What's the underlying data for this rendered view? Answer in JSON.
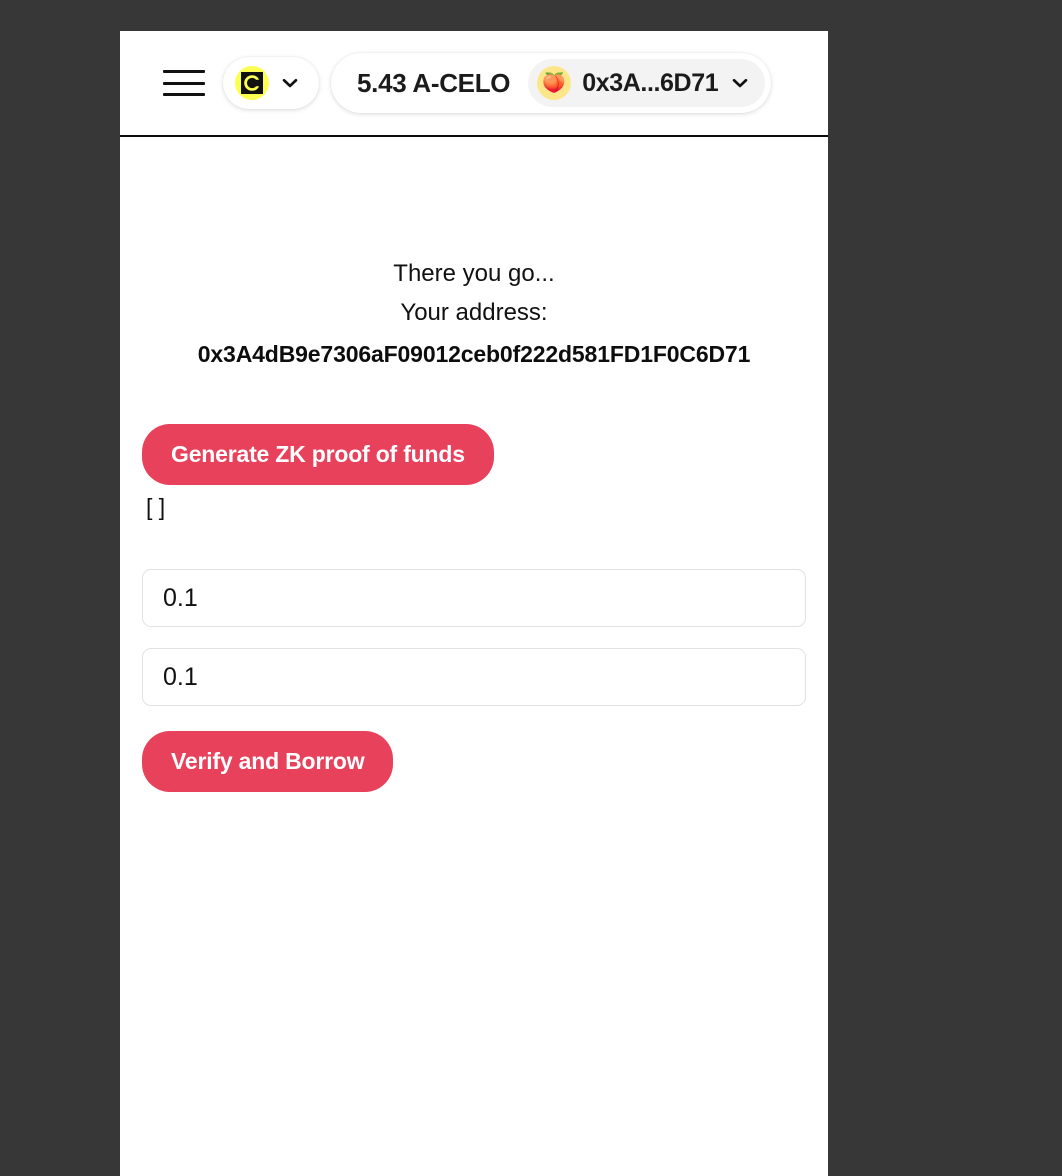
{
  "header": {
    "menu_icon": "hamburger-menu-icon",
    "network": {
      "logo_icon": "celo-logo-icon",
      "chevron_icon": "chevron-down-icon"
    },
    "balance": "5.43 A-CELO",
    "account": {
      "avatar_emoji": "🍑",
      "address_short": "0x3A...6D71",
      "chevron_icon": "chevron-down-icon"
    }
  },
  "main": {
    "greeting": "There you go...",
    "address_label": "Your address:",
    "wallet_address": "0x3A4dB9e7306aF09012ceb0f222d581FD1F0C6D71",
    "generate_proof_label": "Generate ZK proof of funds",
    "proof_output": "[ ]",
    "collateral_value": "0.1",
    "borrow_value": "0.1",
    "verify_borrow_label": "Verify and Borrow"
  },
  "colors": {
    "accent": "#E8415C",
    "celo_yellow": "#FCFF52",
    "page_backdrop": "#373737",
    "avatar_bg": "#FDE68A"
  }
}
